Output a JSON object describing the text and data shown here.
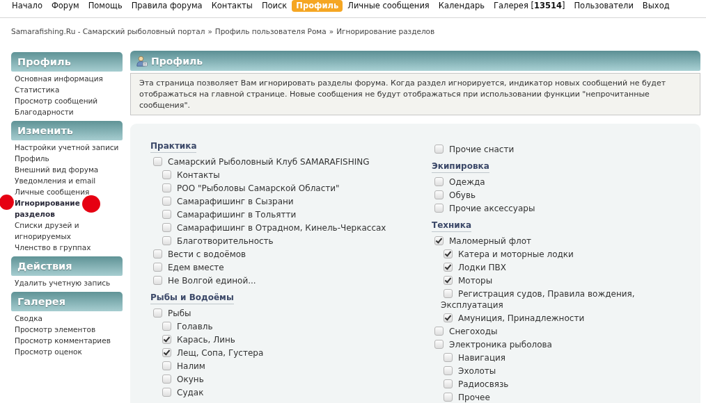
{
  "nav": {
    "items": [
      {
        "label": "Начало",
        "selected": false
      },
      {
        "label": "Форум",
        "selected": false
      },
      {
        "label": "Помощь",
        "selected": false
      },
      {
        "label": "Правила форума",
        "selected": false
      },
      {
        "label": "Контакты",
        "selected": false
      },
      {
        "label": "Поиск",
        "selected": false
      },
      {
        "label": "Профиль",
        "selected": true
      },
      {
        "label": "Личные сообщения",
        "selected": false
      },
      {
        "label": "Календарь",
        "selected": false
      },
      {
        "label": "Галерея [**13514**]",
        "selected": false
      },
      {
        "label": "Пользователи",
        "selected": false
      },
      {
        "label": "Выход",
        "selected": false
      }
    ]
  },
  "breadcrumb": {
    "items": [
      "Samarafishing.Ru - Самарский рыболовный портал",
      "Профиль пользователя Рома",
      "Игнорирование разделов"
    ],
    "separators": [
      "»",
      "»"
    ]
  },
  "sidebar": {
    "sections": [
      {
        "title": "Профиль",
        "items": [
          {
            "label": "Основная информация",
            "selected": false,
            "annotated": false
          },
          {
            "label": "Статистика",
            "selected": false,
            "annotated": false
          },
          {
            "label": "Просмотр сообщений",
            "selected": false,
            "annotated": false
          },
          {
            "label": "Благодарности",
            "selected": false,
            "annotated": false
          }
        ]
      },
      {
        "title": "Изменить",
        "items": [
          {
            "label": "Настройки учетной записи",
            "selected": false,
            "annotated": false
          },
          {
            "label": "Профиль",
            "selected": false,
            "annotated": false
          },
          {
            "label": "Внешний вид форума",
            "selected": false,
            "annotated": false
          },
          {
            "label": "Уведомления и email",
            "selected": false,
            "annotated": false
          },
          {
            "label": "Личные сообщения",
            "selected": false,
            "annotated": false
          },
          {
            "label": "Игнорирование разделов",
            "selected": true,
            "annotated": true
          },
          {
            "label": "Списки друзей и игнорируемых",
            "selected": false,
            "annotated": false
          },
          {
            "label": "Членство в группах",
            "selected": false,
            "annotated": false
          }
        ]
      },
      {
        "title": "Действия",
        "items": [
          {
            "label": "Удалить учетную запись",
            "selected": false,
            "annotated": false
          }
        ]
      },
      {
        "title": "Галерея",
        "items": [
          {
            "label": "Сводка",
            "selected": false,
            "annotated": false
          },
          {
            "label": "Просмотр элементов",
            "selected": false,
            "annotated": false
          },
          {
            "label": "Просмотр комментариев",
            "selected": false,
            "annotated": false
          },
          {
            "label": "Просмотр оценок",
            "selected": false,
            "annotated": false
          }
        ]
      }
    ]
  },
  "main": {
    "title": "Профиль",
    "description": "Эта страница позволяет Вам игнорировать разделы форума. Когда раздел игнорируется, индикатор новых сообщений не будет отображаться на главной странице. Новые сообщения не будут отображаться при использовании функции \"непрочитанные сообщения\".",
    "columns": [
      {
        "sections": [
          {
            "heading": "Практика",
            "items": [
              {
                "label": "Самарский Рыболовный Клуб SAMARAFISHING",
                "checked": false,
                "children": [
                  {
                    "label": "Контакты",
                    "checked": false
                  },
                  {
                    "label": "РОО \"Рыболовы Самарской Области\"",
                    "checked": false
                  },
                  {
                    "label": "Самарафишинг в Сызрани",
                    "checked": false
                  },
                  {
                    "label": "Самарафишинг в Тольятти",
                    "checked": false
                  },
                  {
                    "label": "Самарафишинг в Отрадном, Кинель-Черкассах",
                    "checked": false
                  },
                  {
                    "label": "Благотворительность",
                    "checked": false
                  }
                ]
              },
              {
                "label": "Вести с водоёмов",
                "checked": false
              },
              {
                "label": "Едем вместе",
                "checked": false
              },
              {
                "label": "Не Волгой единой...",
                "checked": false
              }
            ]
          },
          {
            "heading": "Рыбы и Водоёмы",
            "items": [
              {
                "label": "Рыбы",
                "checked": false,
                "children": [
                  {
                    "label": "Голавль",
                    "checked": false
                  },
                  {
                    "label": "Карась, Линь",
                    "checked": true
                  },
                  {
                    "label": "Лещ, Сопа, Густера",
                    "checked": true
                  },
                  {
                    "label": "Налим",
                    "checked": false
                  },
                  {
                    "label": "Окунь",
                    "checked": false
                  },
                  {
                    "label": "Судак",
                    "checked": false
                  }
                ]
              }
            ]
          }
        ]
      },
      {
        "sections": [
          {
            "items": [
              {
                "label": "Прочие снасти",
                "checked": false
              }
            ]
          },
          {
            "heading": "Экипировка",
            "items": [
              {
                "label": "Одежда",
                "checked": false
              },
              {
                "label": "Обувь",
                "checked": false
              },
              {
                "label": "Прочие аксессуары",
                "checked": false
              }
            ]
          },
          {
            "heading": "Техника",
            "items": [
              {
                "label": "Маломерный флот",
                "checked": true,
                "children": [
                  {
                    "label": "Катера и моторные лодки",
                    "checked": true
                  },
                  {
                    "label": "Лодки ПВХ",
                    "checked": true
                  },
                  {
                    "label": "Моторы",
                    "checked": true
                  },
                  {
                    "label": "Регистрация судов, Правила вождения, Эксплуатация",
                    "checked": false
                  },
                  {
                    "label": "Амуниция, Принадлежности",
                    "checked": true
                  }
                ]
              },
              {
                "label": "Снегоходы",
                "checked": false
              },
              {
                "label": "Электроника рыболова",
                "checked": false,
                "children": [
                  {
                    "label": "Навигация",
                    "checked": false
                  },
                  {
                    "label": "Эхолоты",
                    "checked": false
                  },
                  {
                    "label": "Радиосвязь",
                    "checked": false
                  },
                  {
                    "label": "Прочее",
                    "checked": false
                  }
                ]
              }
            ]
          }
        ]
      }
    ]
  }
}
